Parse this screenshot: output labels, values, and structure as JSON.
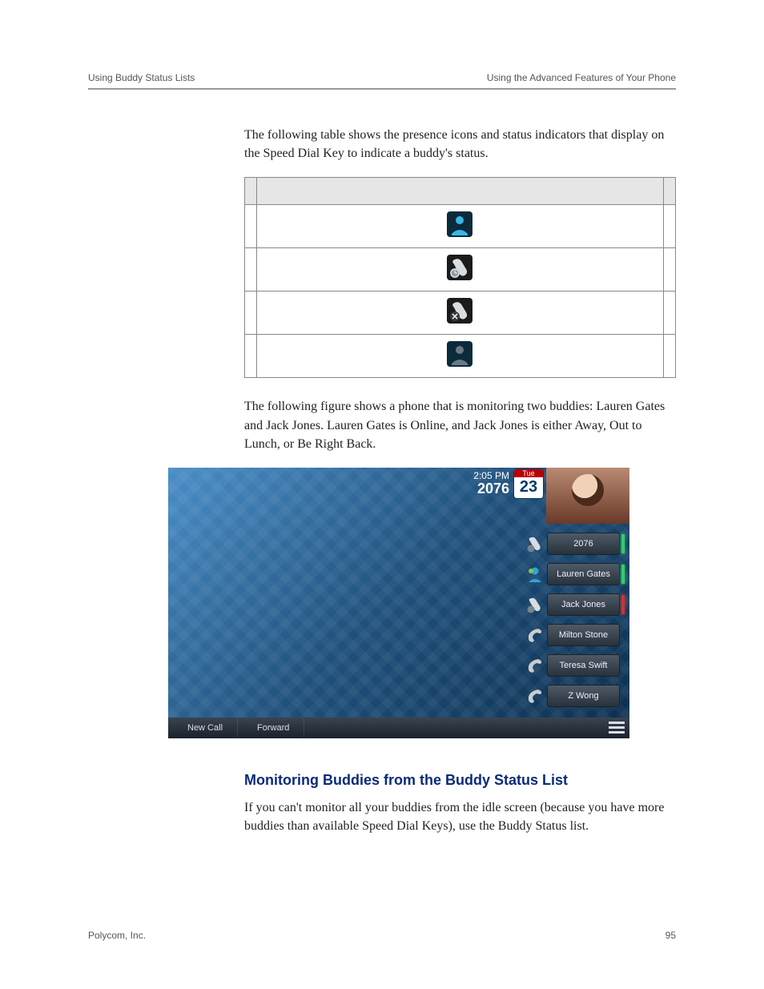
{
  "header": {
    "left": "Using Buddy Status Lists",
    "right": "Using the Advanced Features of Your Phone"
  },
  "intro1": "The following table shows the presence icons and status indicators that display on the Speed Dial Key to indicate a buddy's status.",
  "table": {
    "rows": [
      {
        "icon": "online"
      },
      {
        "icon": "away"
      },
      {
        "icon": "dnd"
      },
      {
        "icon": "offline"
      }
    ]
  },
  "intro2": "The following figure shows a phone that is monitoring two buddies: Lauren Gates and Jack Jones. Lauren Gates is Online, and Jack Jones is either Away, Out to Lunch, or Be Right Back.",
  "phone": {
    "time": "2:05 PM",
    "ext": "2076",
    "cal": {
      "dow": "Tue",
      "dom": "23"
    },
    "keys": [
      {
        "label": "2076",
        "icon": "phone-away",
        "bar": "green"
      },
      {
        "label": "Lauren Gates",
        "icon": "online",
        "bar": "green"
      },
      {
        "label": "Jack Jones",
        "icon": "phone-away",
        "bar": "red"
      },
      {
        "label": "Milton Stone",
        "icon": "handset",
        "bar": ""
      },
      {
        "label": "Teresa Swift",
        "icon": "handset",
        "bar": ""
      },
      {
        "label": "Z Wong",
        "icon": "handset",
        "bar": ""
      }
    ],
    "soft": {
      "k1": "New Call",
      "k2": "Forward"
    }
  },
  "section": {
    "title": "Monitoring Buddies from the Buddy Status List",
    "body": "If you can't monitor all your buddies from the idle screen (because you have more buddies than available Speed Dial Keys), use the Buddy Status list."
  },
  "footer": {
    "left": "Polycom, Inc.",
    "right": "95"
  }
}
